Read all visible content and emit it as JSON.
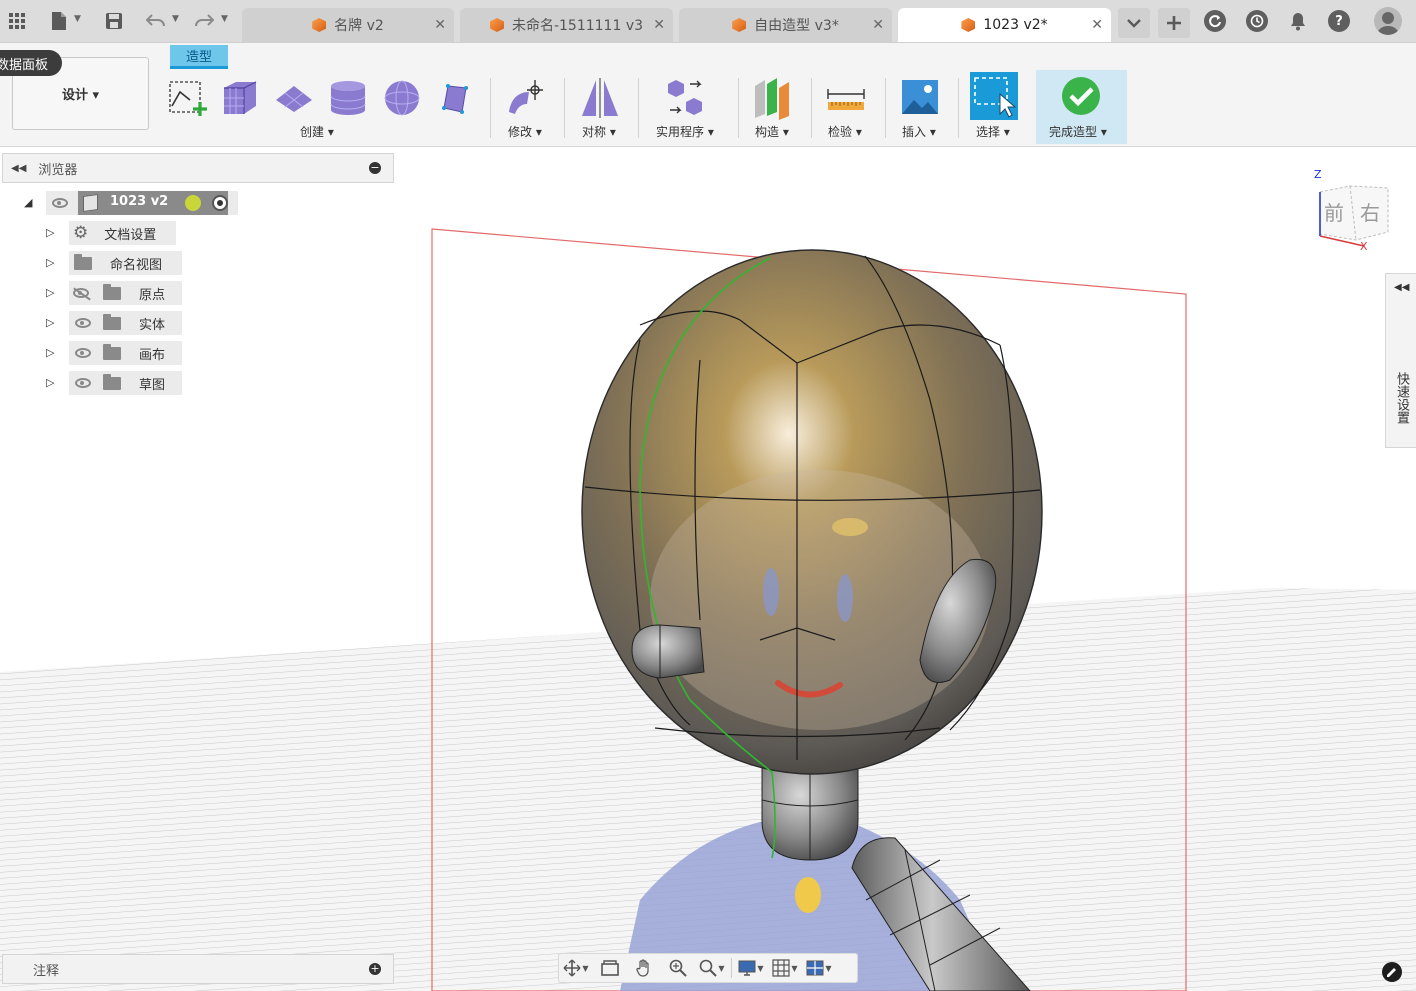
{
  "tabs": [
    {
      "title": "名牌 v2",
      "active": false
    },
    {
      "title": "未命名-1511111 v3",
      "active": false
    },
    {
      "title": "自由造型 v3*",
      "active": false
    },
    {
      "title": "1023 v2*",
      "active": true
    }
  ],
  "tabbar_icons": {
    "grid": "grid-icon",
    "file": "file-icon",
    "save": "save-icon",
    "undo": "undo-icon",
    "redo": "redo-icon",
    "tab_list": "chevron-down-icon",
    "new_tab": "plus-icon",
    "sync": "sync-icon",
    "history": "clock-icon",
    "notifications": "bell-icon",
    "help": "help-icon",
    "avatar": "avatar-icon",
    "help_glyph": "?"
  },
  "data_panel_label": "数据面板",
  "workspace": {
    "label": "设计 ▾"
  },
  "active_workspace_tab": "造型",
  "ribbon_groups": {
    "create": "创建 ▾",
    "modify": "修改 ▾",
    "symmetry": "对称 ▾",
    "utilities": "实用程序 ▾",
    "construct": "构造 ▾",
    "inspect": "检验 ▾",
    "insert": "插入 ▾",
    "select": "选择 ▾",
    "finish": "完成造型 ▾"
  },
  "browser": {
    "title": "浏览器",
    "root": "1023 v2",
    "items": [
      {
        "label": "文档设置",
        "icon": "gear-icon"
      },
      {
        "label": "命名视图",
        "icon": "folder-icon"
      },
      {
        "label": "原点",
        "icon": "folder-icon",
        "hidden": true
      },
      {
        "label": "实体",
        "icon": "folder-icon"
      },
      {
        "label": "画布",
        "icon": "folder-icon"
      },
      {
        "label": "草图",
        "icon": "folder-icon"
      }
    ]
  },
  "notes": {
    "title": "注释"
  },
  "viewcube": {
    "axis_z": "Z",
    "axis_x": "X",
    "face_front": "前",
    "face_right": "右"
  },
  "quick_settings": {
    "label": "快速设置"
  },
  "colors": {
    "accent": "#1a9ad6",
    "finish_green": "#3ab34a",
    "canvas_red": "#e26b6b",
    "sketch_green": "#2fb82f"
  }
}
